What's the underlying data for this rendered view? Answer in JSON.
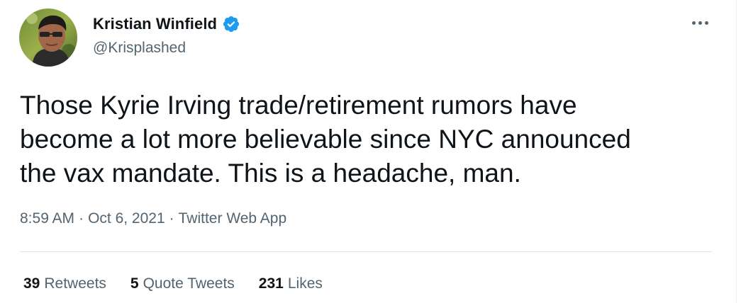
{
  "author": {
    "name": "Kristian Winfield",
    "handle": "@Krisplashed",
    "verified": true
  },
  "tweet": {
    "text": "Those Kyrie Irving trade/retirement rumors have\nbecome a lot more believable since NYC announced\nthe vax mandate. This is a headache, man."
  },
  "meta": {
    "time": "8:59 AM",
    "separator": "·",
    "date": "Oct 6, 2021",
    "source": "Twitter Web App"
  },
  "stats": {
    "retweets_count": "39",
    "retweets_label": "Retweets",
    "quote_count": "5",
    "quote_label": "Quote Tweets",
    "likes_count": "231",
    "likes_label": "Likes"
  },
  "icons": {
    "verified": "verified-badge-icon",
    "more": "more-options-icon"
  },
  "colors": {
    "verified_blue": "#1d9bf0",
    "text_primary": "#0f1419",
    "text_secondary": "#536471",
    "divider": "#e1e6ea"
  }
}
